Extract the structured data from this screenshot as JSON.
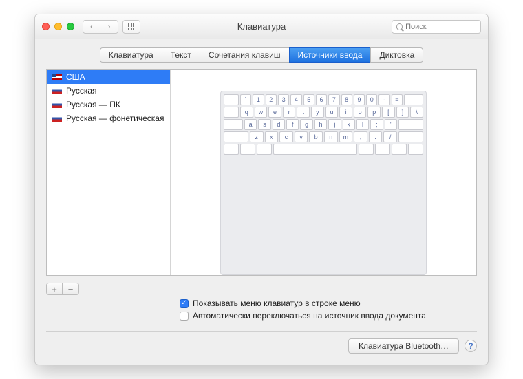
{
  "window": {
    "title": "Клавиатура"
  },
  "search": {
    "placeholder": "Поиск"
  },
  "tabs": [
    {
      "label": "Клавиатура",
      "active": false
    },
    {
      "label": "Текст",
      "active": false
    },
    {
      "label": "Сочетания клавиш",
      "active": false
    },
    {
      "label": "Источники ввода",
      "active": true
    },
    {
      "label": "Диктовка",
      "active": false
    }
  ],
  "sources": [
    {
      "label": "США",
      "flag": "us",
      "selected": true
    },
    {
      "label": "Русская",
      "flag": "ru",
      "selected": false
    },
    {
      "label": "Русская — ПК",
      "flag": "ru",
      "selected": false
    },
    {
      "label": "Русская — фонетическая",
      "flag": "ru",
      "selected": false
    }
  ],
  "keyboard": {
    "rows": [
      [
        "`",
        "1",
        "2",
        "3",
        "4",
        "5",
        "6",
        "7",
        "8",
        "9",
        "0",
        "-",
        "="
      ],
      [
        "q",
        "w",
        "e",
        "r",
        "t",
        "y",
        "u",
        "i",
        "o",
        "p",
        "[",
        "]",
        "\\"
      ],
      [
        "a",
        "s",
        "d",
        "f",
        "g",
        "h",
        "j",
        "k",
        "l",
        ";",
        "'"
      ],
      [
        "z",
        "x",
        "c",
        "v",
        "b",
        "n",
        "m",
        ",",
        ".",
        "/"
      ]
    ]
  },
  "add_remove": {
    "add": "+",
    "remove": "−"
  },
  "options": {
    "show_menu": {
      "label": "Показывать меню клавиатур в строке меню",
      "checked": true
    },
    "auto_switch": {
      "label": "Автоматически переключаться на источник ввода документа",
      "checked": false
    }
  },
  "footer": {
    "bluetooth_button": "Клавиатура Bluetooth…",
    "help": "?"
  }
}
